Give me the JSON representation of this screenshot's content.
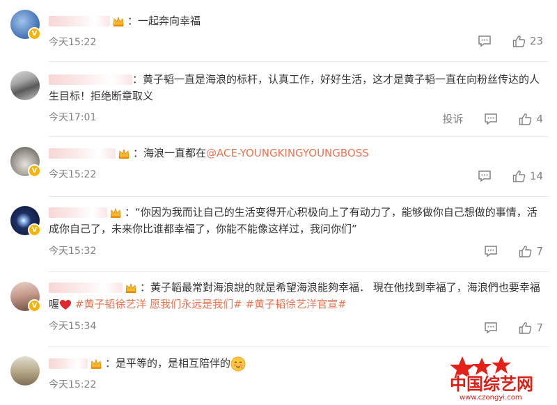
{
  "comments": [
    {
      "text": "：一起奔向幸福",
      "time": "今天15:22",
      "likes": "23",
      "report": ""
    },
    {
      "text": "：黄子韬一直是海浪的标杆，认真工作，好好生活，这才是黄子韬一直在向粉丝传达的人生目标！拒绝断章取义",
      "time": "今天17:01",
      "likes": "4",
      "report": "投诉"
    },
    {
      "text_before": "：海浪一直都在",
      "mention": "@ACE-YOUNGKINGYOUNGBOSS",
      "time": "今天15:22",
      "likes": "14"
    },
    {
      "text": "：“你因为我而让自己的生活变得开心积极向上了有动力了，能够做你自己想做的事情，活成你自己了，未来你比谁都幸福了，你能不能像这样过，我问你们”",
      "time": "今天15:32",
      "likes": "7"
    },
    {
      "text_before": "：黃子韜最常對海浪說的就是希望海浪能夠幸福． 現在他找到幸福了，海浪們也要幸福喔",
      "tag1": "#黄子韬徐艺洋 愿我们永远是我们#",
      "tag2": "#黄子韬徐艺洋官宣#",
      "time": "今天15:34",
      "likes": "7"
    },
    {
      "text": "：是平等的，是相互陪伴的",
      "time": "今天15:22"
    }
  ],
  "watermark": {
    "brand": "中国综艺网",
    "url": "www.czongyi.com"
  },
  "colors": {
    "link": "#eb7350",
    "meta": "#808080",
    "badge": "#f6b400"
  }
}
